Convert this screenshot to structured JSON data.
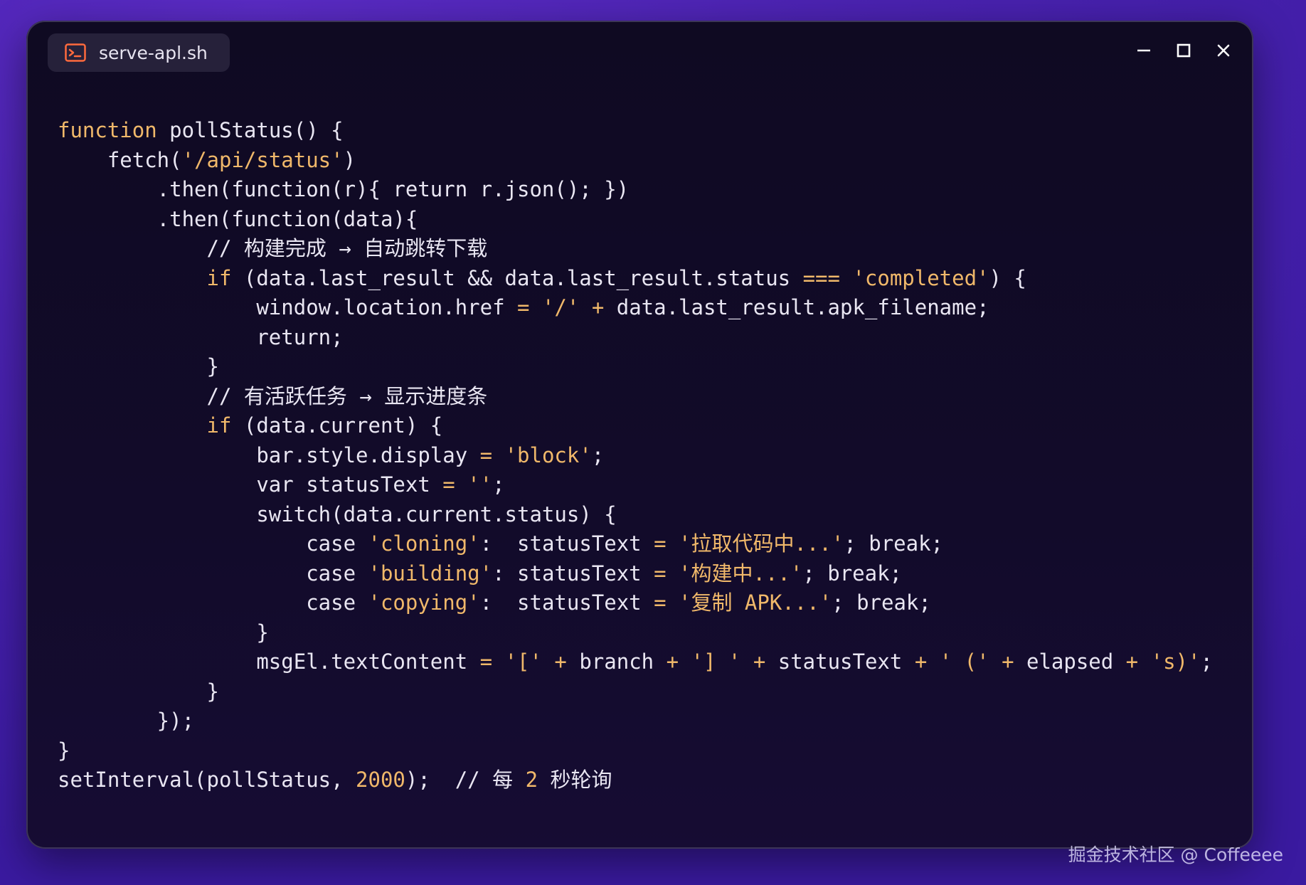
{
  "window": {
    "tab_title": "serve-apl.sh",
    "tab_icon": "terminal-icon",
    "controls": [
      "minimize-icon",
      "maximize-icon",
      "close-icon"
    ]
  },
  "code_lines": [
    [
      [
        "kw",
        "function"
      ],
      [
        "t",
        " pollStatus() {"
      ]
    ],
    [
      [
        "t",
        "    fetch("
      ],
      [
        "str",
        "'/api/status'"
      ],
      [
        "t",
        ")"
      ]
    ],
    [
      [
        "t",
        "        .then(function(r){ return r.json(); })"
      ]
    ],
    [
      [
        "t",
        "        .then(function(data){"
      ]
    ],
    [
      [
        "cm",
        "            // 构建完成 → 自动跳转下载"
      ]
    ],
    [
      [
        "t",
        "            "
      ],
      [
        "kw",
        "if"
      ],
      [
        "t",
        " (data.last_result && data.last_result.status "
      ],
      [
        "op",
        "==="
      ],
      [
        "t",
        " "
      ],
      [
        "str",
        "'completed'"
      ],
      [
        "t",
        ") {"
      ]
    ],
    [
      [
        "t",
        "                window.location.href "
      ],
      [
        "op",
        "="
      ],
      [
        "t",
        " "
      ],
      [
        "str",
        "'/'"
      ],
      [
        "t",
        " "
      ],
      [
        "op",
        "+"
      ],
      [
        "t",
        " data.last_result.apk_filename;"
      ]
    ],
    [
      [
        "t",
        "                return;"
      ]
    ],
    [
      [
        "t",
        "            }"
      ]
    ],
    [
      [
        "cm",
        "            // 有活跃任务 → 显示进度条"
      ]
    ],
    [
      [
        "t",
        "            "
      ],
      [
        "kw",
        "if"
      ],
      [
        "t",
        " (data.current) {"
      ]
    ],
    [
      [
        "t",
        "                bar.style.display "
      ],
      [
        "op",
        "="
      ],
      [
        "t",
        " "
      ],
      [
        "str",
        "'block'"
      ],
      [
        "t",
        ";"
      ]
    ],
    [
      [
        "t",
        "                var statusText "
      ],
      [
        "op",
        "="
      ],
      [
        "t",
        " "
      ],
      [
        "str",
        "''"
      ],
      [
        "t",
        ";"
      ]
    ],
    [
      [
        "t",
        "                switch(data.current.status) {"
      ]
    ],
    [
      [
        "t",
        "                    case "
      ],
      [
        "str",
        "'cloning'"
      ],
      [
        "t",
        ":  statusText "
      ],
      [
        "op",
        "="
      ],
      [
        "t",
        " "
      ],
      [
        "str",
        "'拉取代码中...'"
      ],
      [
        "t",
        "; break;"
      ]
    ],
    [
      [
        "t",
        "                    case "
      ],
      [
        "str",
        "'building'"
      ],
      [
        "t",
        ": statusText "
      ],
      [
        "op",
        "="
      ],
      [
        "t",
        " "
      ],
      [
        "str",
        "'构建中...'"
      ],
      [
        "t",
        "; break;"
      ]
    ],
    [
      [
        "t",
        "                    case "
      ],
      [
        "str",
        "'copying'"
      ],
      [
        "t",
        ":  statusText "
      ],
      [
        "op",
        "="
      ],
      [
        "t",
        " "
      ],
      [
        "str",
        "'复制 APK...'"
      ],
      [
        "t",
        "; break;"
      ]
    ],
    [
      [
        "t",
        "                }"
      ]
    ],
    [
      [
        "t",
        "                msgEl.textContent "
      ],
      [
        "op",
        "="
      ],
      [
        "t",
        " "
      ],
      [
        "str",
        "'['"
      ],
      [
        "t",
        " "
      ],
      [
        "op",
        "+"
      ],
      [
        "t",
        " branch "
      ],
      [
        "op",
        "+"
      ],
      [
        "t",
        " "
      ],
      [
        "str",
        "'] '"
      ],
      [
        "t",
        " "
      ],
      [
        "op",
        "+"
      ],
      [
        "t",
        " statusText "
      ],
      [
        "op",
        "+"
      ],
      [
        "t",
        " "
      ],
      [
        "str",
        "' ('"
      ],
      [
        "t",
        " "
      ],
      [
        "op",
        "+"
      ],
      [
        "t",
        " elapsed "
      ],
      [
        "op",
        "+"
      ],
      [
        "t",
        " "
      ],
      [
        "str",
        "'s)'"
      ],
      [
        "t",
        ";"
      ]
    ],
    [
      [
        "t",
        "            }"
      ]
    ],
    [
      [
        "t",
        "        });"
      ]
    ],
    [
      [
        "t",
        "}"
      ]
    ],
    [
      [
        "t",
        "setInterval(pollStatus, "
      ],
      [
        "num",
        "2000"
      ],
      [
        "t",
        ");  // 每 "
      ],
      [
        "num",
        "2"
      ],
      [
        "t",
        " 秒轮询"
      ]
    ]
  ],
  "watermark": "掘金技术社区 @ Coffeeee",
  "colors": {
    "keyword": "#f0b86a",
    "text": "#e9e6f2",
    "background": "#120b2a",
    "accent_icon": "#ff6a3d"
  }
}
